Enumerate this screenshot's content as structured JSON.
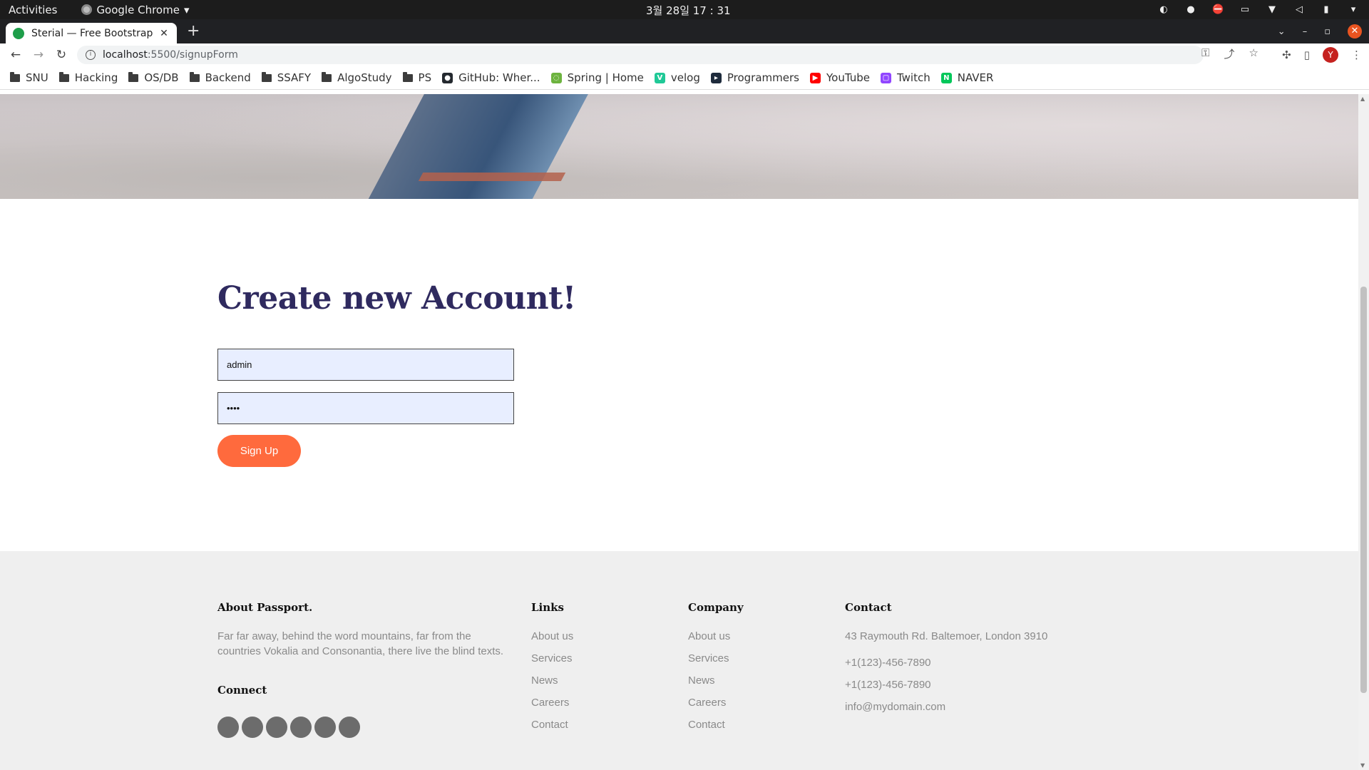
{
  "system": {
    "activities": "Activities",
    "app_name": "Google Chrome",
    "clock": "3월 28일  17 : 31"
  },
  "browser": {
    "tab_title": "Sterial — Free Bootstrap",
    "url_host": "localhost",
    "url_path": ":5500/signupForm",
    "avatar_letter": "Y",
    "bookmarks": [
      {
        "label": "SNU",
        "type": "folder"
      },
      {
        "label": "Hacking",
        "type": "folder"
      },
      {
        "label": "OS/DB",
        "type": "folder"
      },
      {
        "label": "Backend",
        "type": "folder"
      },
      {
        "label": "SSAFY",
        "type": "folder"
      },
      {
        "label": "AlgoStudy",
        "type": "folder"
      },
      {
        "label": "PS",
        "type": "folder"
      },
      {
        "label": "GitHub: Wher...",
        "type": "github"
      },
      {
        "label": "Spring | Home",
        "type": "spring"
      },
      {
        "label": "velog",
        "type": "velog"
      },
      {
        "label": "Programmers",
        "type": "programmers"
      },
      {
        "label": "YouTube",
        "type": "youtube"
      },
      {
        "label": "Twitch",
        "type": "twitch"
      },
      {
        "label": "NAVER",
        "type": "naver"
      }
    ]
  },
  "page": {
    "heading": "Create new Account!",
    "username_value": "admin",
    "password_value": "••••",
    "signup_label": "Sign Up"
  },
  "footer": {
    "about_title": "About Passport.",
    "about_text": "Far far away, behind the word mountains, far from the countries Vokalia and Consonantia, there live the blind texts.",
    "connect_title": "Connect",
    "links_title": "Links",
    "links": [
      "About us",
      "Services",
      "News",
      "Careers",
      "Contact"
    ],
    "company_title": "Company",
    "company": [
      "About us",
      "Services",
      "News",
      "Careers",
      "Contact"
    ],
    "contact_title": "Contact",
    "address": "43 Raymouth Rd. Baltemoer, London 3910",
    "phone1": "+1(123)-456-7890",
    "phone2": "+1(123)-456-7890",
    "email": "info@mydomain.com"
  },
  "colors": {
    "heading": "#2f2a5f",
    "signup_button": "#ff6a3d",
    "input_bg": "#e8eeff",
    "footer_bg": "#efefef"
  }
}
